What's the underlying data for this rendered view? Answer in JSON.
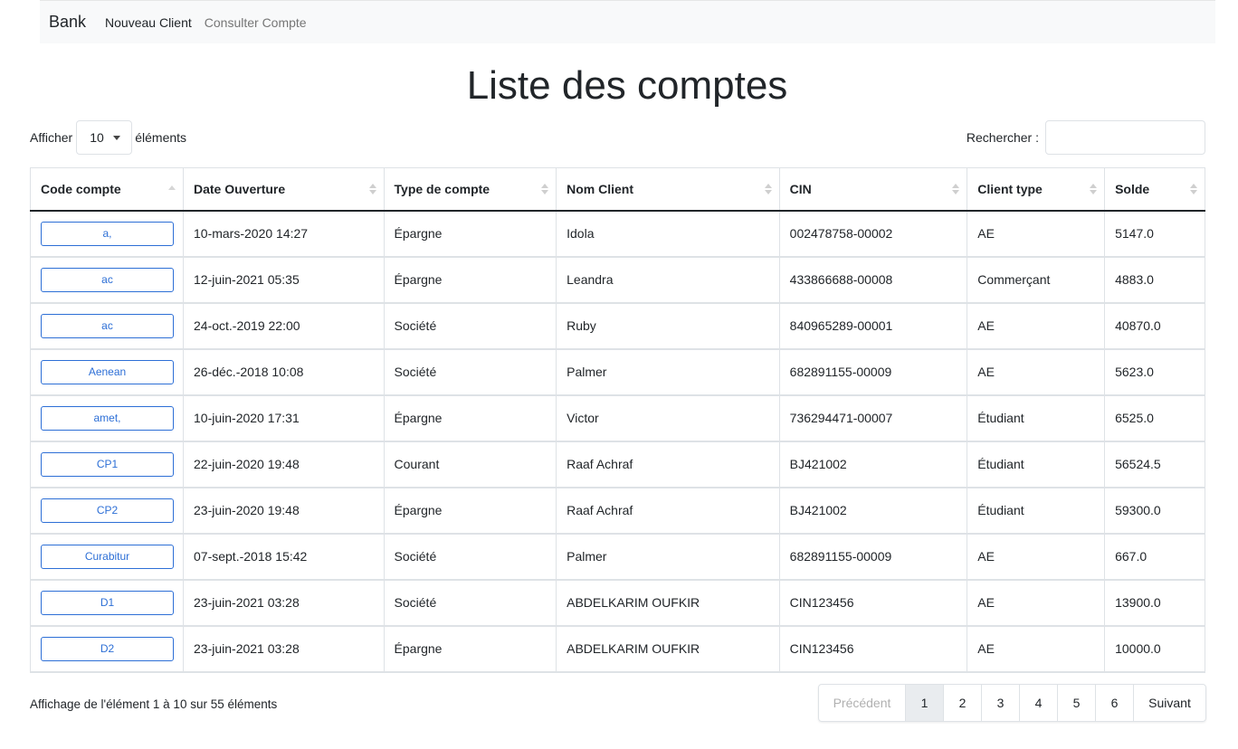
{
  "navbar": {
    "brand": "Bank",
    "links": [
      {
        "label": "Nouveau Client"
      },
      {
        "label": "Consulter Compte"
      }
    ]
  },
  "page_title": "Liste des comptes",
  "length": {
    "prefix": "Afficher",
    "value": "10",
    "suffix": "éléments"
  },
  "search": {
    "label": "Rechercher :",
    "value": ""
  },
  "table": {
    "columns": [
      "Code compte",
      "Date Ouverture",
      "Type de compte",
      "Nom Client",
      "CIN",
      "Client type",
      "Solde"
    ],
    "rows": [
      {
        "code": "a,",
        "date": "10-mars-2020 14:27",
        "type": "Épargne",
        "client": "Idola",
        "cin": "002478758-00002",
        "client_type": "AE",
        "solde": "5147.0"
      },
      {
        "code": "ac",
        "date": "12-juin-2021 05:35",
        "type": "Épargne",
        "client": "Leandra",
        "cin": "433866688-00008",
        "client_type": "Commerçant",
        "solde": "4883.0"
      },
      {
        "code": "ac",
        "date": "24-oct.-2019 22:00",
        "type": "Société",
        "client": "Ruby",
        "cin": "840965289-00001",
        "client_type": "AE",
        "solde": "40870.0"
      },
      {
        "code": "Aenean",
        "date": "26-déc.-2018 10:08",
        "type": "Société",
        "client": "Palmer",
        "cin": "682891155-00009",
        "client_type": "AE",
        "solde": "5623.0"
      },
      {
        "code": "amet,",
        "date": "10-juin-2020 17:31",
        "type": "Épargne",
        "client": "Victor",
        "cin": "736294471-00007",
        "client_type": "Étudiant",
        "solde": "6525.0"
      },
      {
        "code": "CP1",
        "date": "22-juin-2020 19:48",
        "type": "Courant",
        "client": "Raaf Achraf",
        "cin": "BJ421002",
        "client_type": "Étudiant",
        "solde": "56524.5"
      },
      {
        "code": "CP2",
        "date": "23-juin-2020 19:48",
        "type": "Épargne",
        "client": "Raaf Achraf",
        "cin": "BJ421002",
        "client_type": "Étudiant",
        "solde": "59300.0"
      },
      {
        "code": "Curabitur",
        "date": "07-sept.-2018 15:42",
        "type": "Société",
        "client": "Palmer",
        "cin": "682891155-00009",
        "client_type": "AE",
        "solde": "667.0"
      },
      {
        "code": "D1",
        "date": "23-juin-2021 03:28",
        "type": "Société",
        "client": "ABDELKARIM OUFKIR",
        "cin": "CIN123456",
        "client_type": "AE",
        "solde": "13900.0"
      },
      {
        "code": "D2",
        "date": "23-juin-2021 03:28",
        "type": "Épargne",
        "client": "ABDELKARIM OUFKIR",
        "cin": "CIN123456",
        "client_type": "AE",
        "solde": "10000.0"
      }
    ]
  },
  "info": "Affichage de l'élément 1 à 10 sur 55 éléments",
  "pagination": {
    "prev": "Précédent",
    "pages": [
      "1",
      "2",
      "3",
      "4",
      "5",
      "6"
    ],
    "active_page": "1",
    "next": "Suivant"
  },
  "colors": {
    "accent": "#2d6fd6",
    "navbar_bg": "#f8f9fa",
    "border": "#dee2e6"
  }
}
